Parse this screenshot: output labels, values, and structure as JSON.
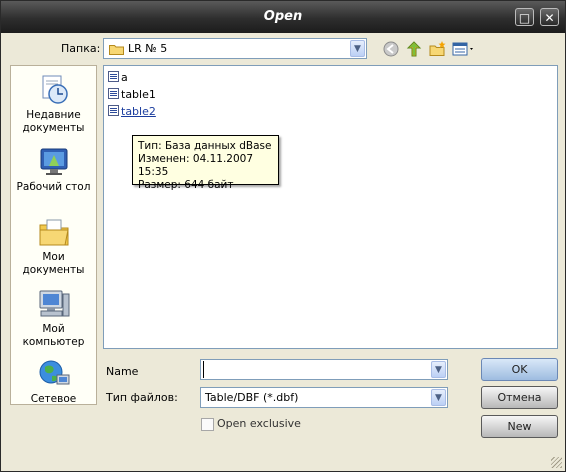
{
  "window": {
    "title": "Open"
  },
  "look_in": {
    "label": "Папка:",
    "value": "LR № 5"
  },
  "places": [
    {
      "label": "Недавние документы",
      "icon": "recent-documents-icon"
    },
    {
      "label": "Рабочий стол",
      "icon": "desktop-icon"
    },
    {
      "label": "Мои документы",
      "icon": "my-documents-icon"
    },
    {
      "label": "Мой компьютер",
      "icon": "my-computer-icon"
    },
    {
      "label": "Сетевое",
      "icon": "network-icon"
    }
  ],
  "files": [
    {
      "name": "a"
    },
    {
      "name": "table1"
    },
    {
      "name": "table2"
    }
  ],
  "tooltip": {
    "line1": "Тип: База данных dBase",
    "line2": "Изменен: 04.11.2007 15:35",
    "line3": "Размер: 644 байт"
  },
  "name_field": {
    "label": "Name",
    "value": ""
  },
  "file_type": {
    "label": "Тип файлов:",
    "value": "Table/DBF (*.dbf)"
  },
  "exclusive": {
    "label": "Open exclusive",
    "checked": false
  },
  "buttons": {
    "ok": "OK",
    "cancel": "Отмена",
    "new": "New"
  }
}
